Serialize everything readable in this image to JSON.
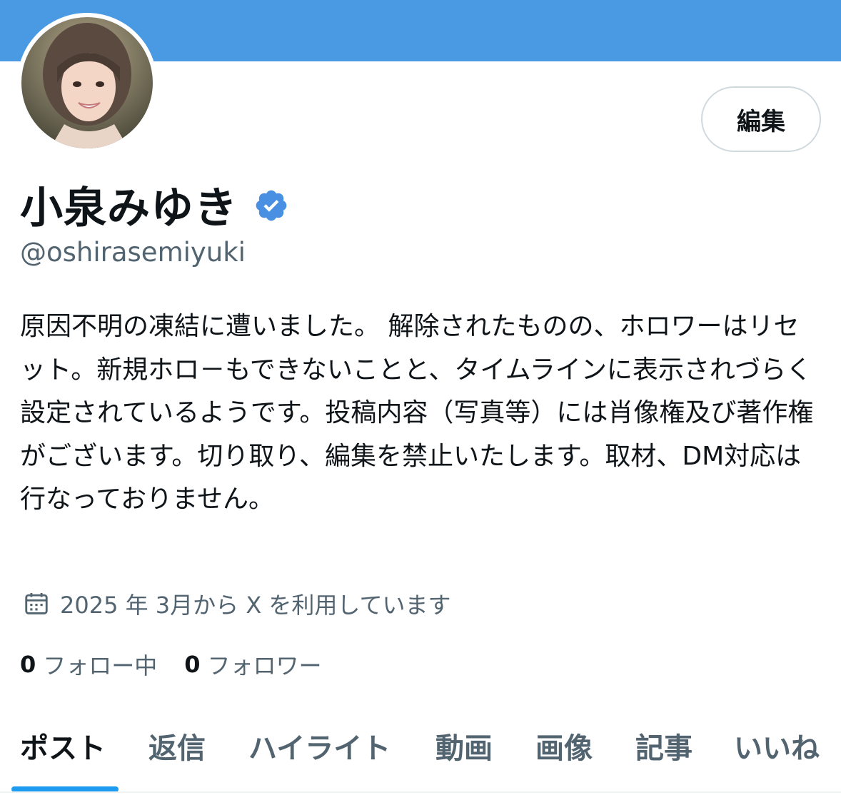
{
  "colors": {
    "banner": "#4a99e3",
    "accent": "#1d9bf0",
    "verified": "#4a90e2",
    "text_primary": "#0f1419",
    "text_secondary": "#536471"
  },
  "profile": {
    "edit_label": "編集",
    "display_name": "小泉みゆき",
    "verified_icon": "verified-badge-icon",
    "handle": "@oshirasemiyuki",
    "bio": "原因不明の凍結に遭いました。 解除されたものの、ホロワーはリセット。新規ホロ－もできないことと、タイムラインに表示されづらく設定されているようです。投稿内容（写真等）には肖像権及び著作権がございます。切り取り、編集を禁止いたします。取材、DM対応は行なっておりません。",
    "joined_icon": "calendar-icon",
    "joined": "2025 年 3月から X を利用しています",
    "following_count": "0",
    "following_label": "フォロー中",
    "followers_count": "0",
    "followers_label": "フォロワー"
  },
  "tabs": [
    {
      "label": "ポスト",
      "active": true
    },
    {
      "label": "返信",
      "active": false
    },
    {
      "label": "ハイライト",
      "active": false
    },
    {
      "label": "動画",
      "active": false
    },
    {
      "label": "画像",
      "active": false
    },
    {
      "label": "記事",
      "active": false
    },
    {
      "label": "いいね",
      "active": false
    }
  ]
}
